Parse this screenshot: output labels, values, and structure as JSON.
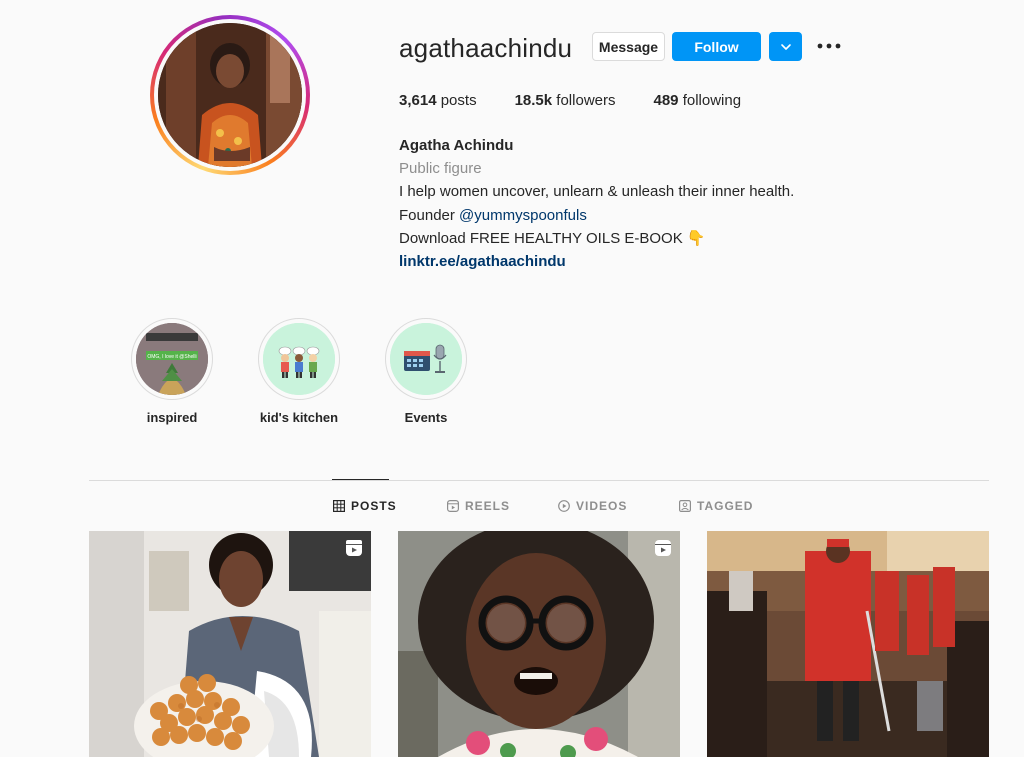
{
  "profile": {
    "username": "agathaachindu",
    "message_label": "Message",
    "follow_label": "Follow",
    "dropdown_icon": "chevron-down-icon",
    "more_icon": "more-options-icon",
    "stats": {
      "posts_count": "3,614",
      "posts_label": "posts",
      "followers_count": "18.5k",
      "followers_label": "followers",
      "following_count": "489",
      "following_label": "following"
    },
    "bio": {
      "name": "Agatha Achindu",
      "category": "Public figure",
      "line1": "I help women uncover, unlearn & unleash their inner health.",
      "line2_prefix": "Founder ",
      "line2_mention": "@yummyspoonfuls",
      "line3": "Download FREE HEALTHY OILS E-BOOK 👇",
      "link": "linktr.ee/agathaachindu"
    }
  },
  "highlights": [
    {
      "label": "inspired",
      "cover_text": "OMG, I love it @Shelli"
    },
    {
      "label": "kid's kitchen"
    },
    {
      "label": "Events"
    }
  ],
  "tabs": [
    {
      "label": "POSTS",
      "icon": "grid-icon",
      "active": true
    },
    {
      "label": "REELS",
      "icon": "reels-icon",
      "active": false
    },
    {
      "label": "VIDEOS",
      "icon": "video-icon",
      "active": false
    },
    {
      "label": "TAGGED",
      "icon": "tagged-icon",
      "active": false
    }
  ],
  "posts": [
    {
      "type": "reel",
      "icon": "reel-icon"
    },
    {
      "type": "reel",
      "icon": "reel-icon"
    },
    {
      "type": "image"
    }
  ],
  "colors": {
    "accent": "#0095f6",
    "link": "#00376b",
    "muted": "#8e8e8e",
    "text": "#262626"
  }
}
